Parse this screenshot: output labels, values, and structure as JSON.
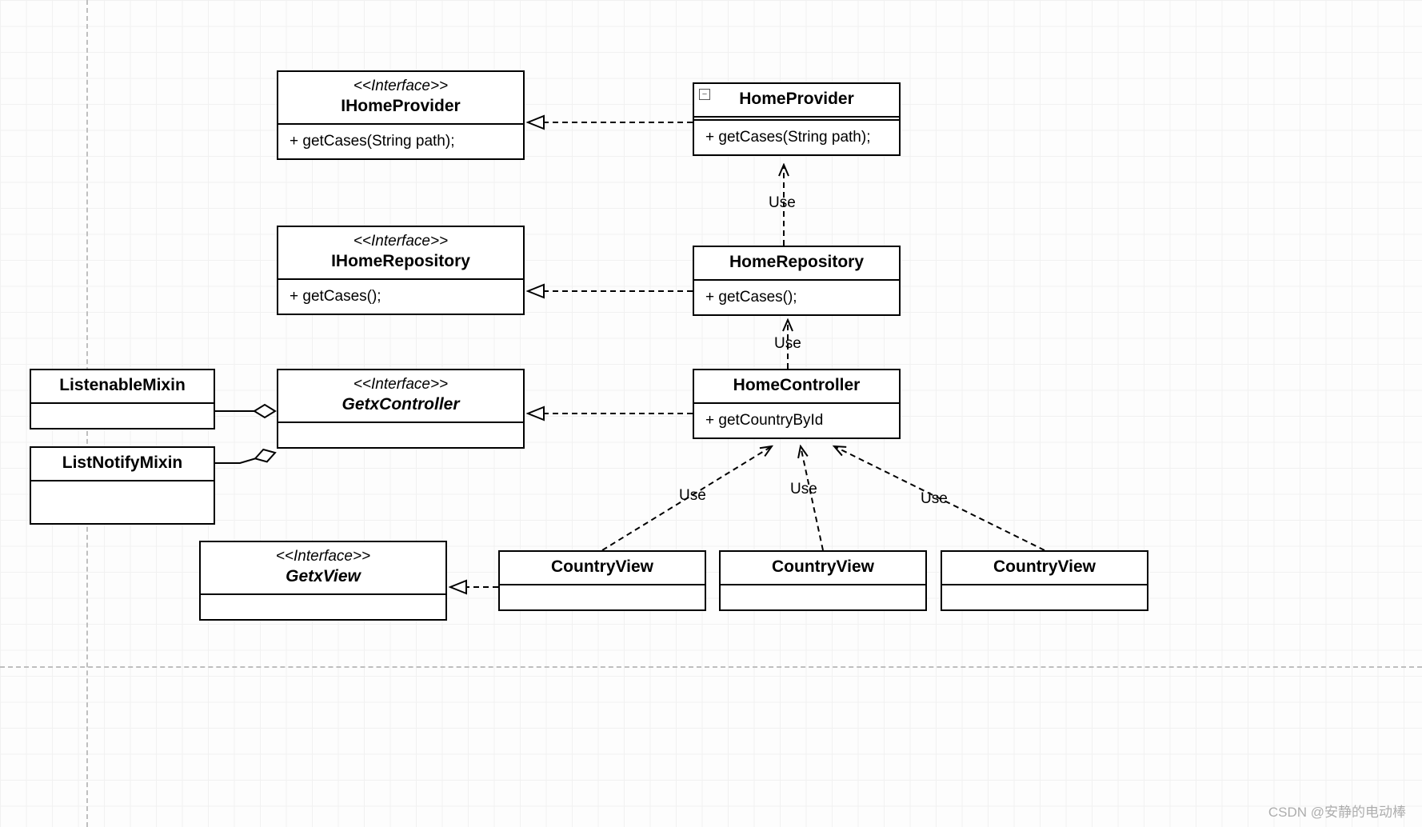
{
  "classes": {
    "iHomeProvider": {
      "stereo": "<<Interface>>",
      "name": "IHomeProvider",
      "member": "+ getCases(String path);"
    },
    "homeProvider": {
      "name": "HomeProvider",
      "member": "+ getCases(String path);"
    },
    "iHomeRepository": {
      "stereo": "<<Interface>>",
      "name": "IHomeRepository",
      "member": "+  getCases();"
    },
    "homeRepository": {
      "name": "HomeRepository",
      "member": "+ getCases();"
    },
    "getxController": {
      "stereo": "<<Interface>>",
      "name": "GetxController"
    },
    "homeController": {
      "name": "HomeController",
      "member": "+ getCountryById"
    },
    "listenableMixin": {
      "name": "ListenableMixin"
    },
    "listNotifyMixin": {
      "name": "ListNotifyMixin"
    },
    "getxView": {
      "stereo": "<<Interface>>",
      "name": "GetxView"
    },
    "countryView1": {
      "name": "CountryView"
    },
    "countryView2": {
      "name": "CountryView"
    },
    "countryView3": {
      "name": "CountryView"
    }
  },
  "labels": {
    "use_provider": "Use",
    "use_repo": "Use",
    "use_v1": "Use",
    "use_v2": "Use",
    "use_v3": "Use"
  },
  "watermark": "CSDN @安静的电动棒"
}
